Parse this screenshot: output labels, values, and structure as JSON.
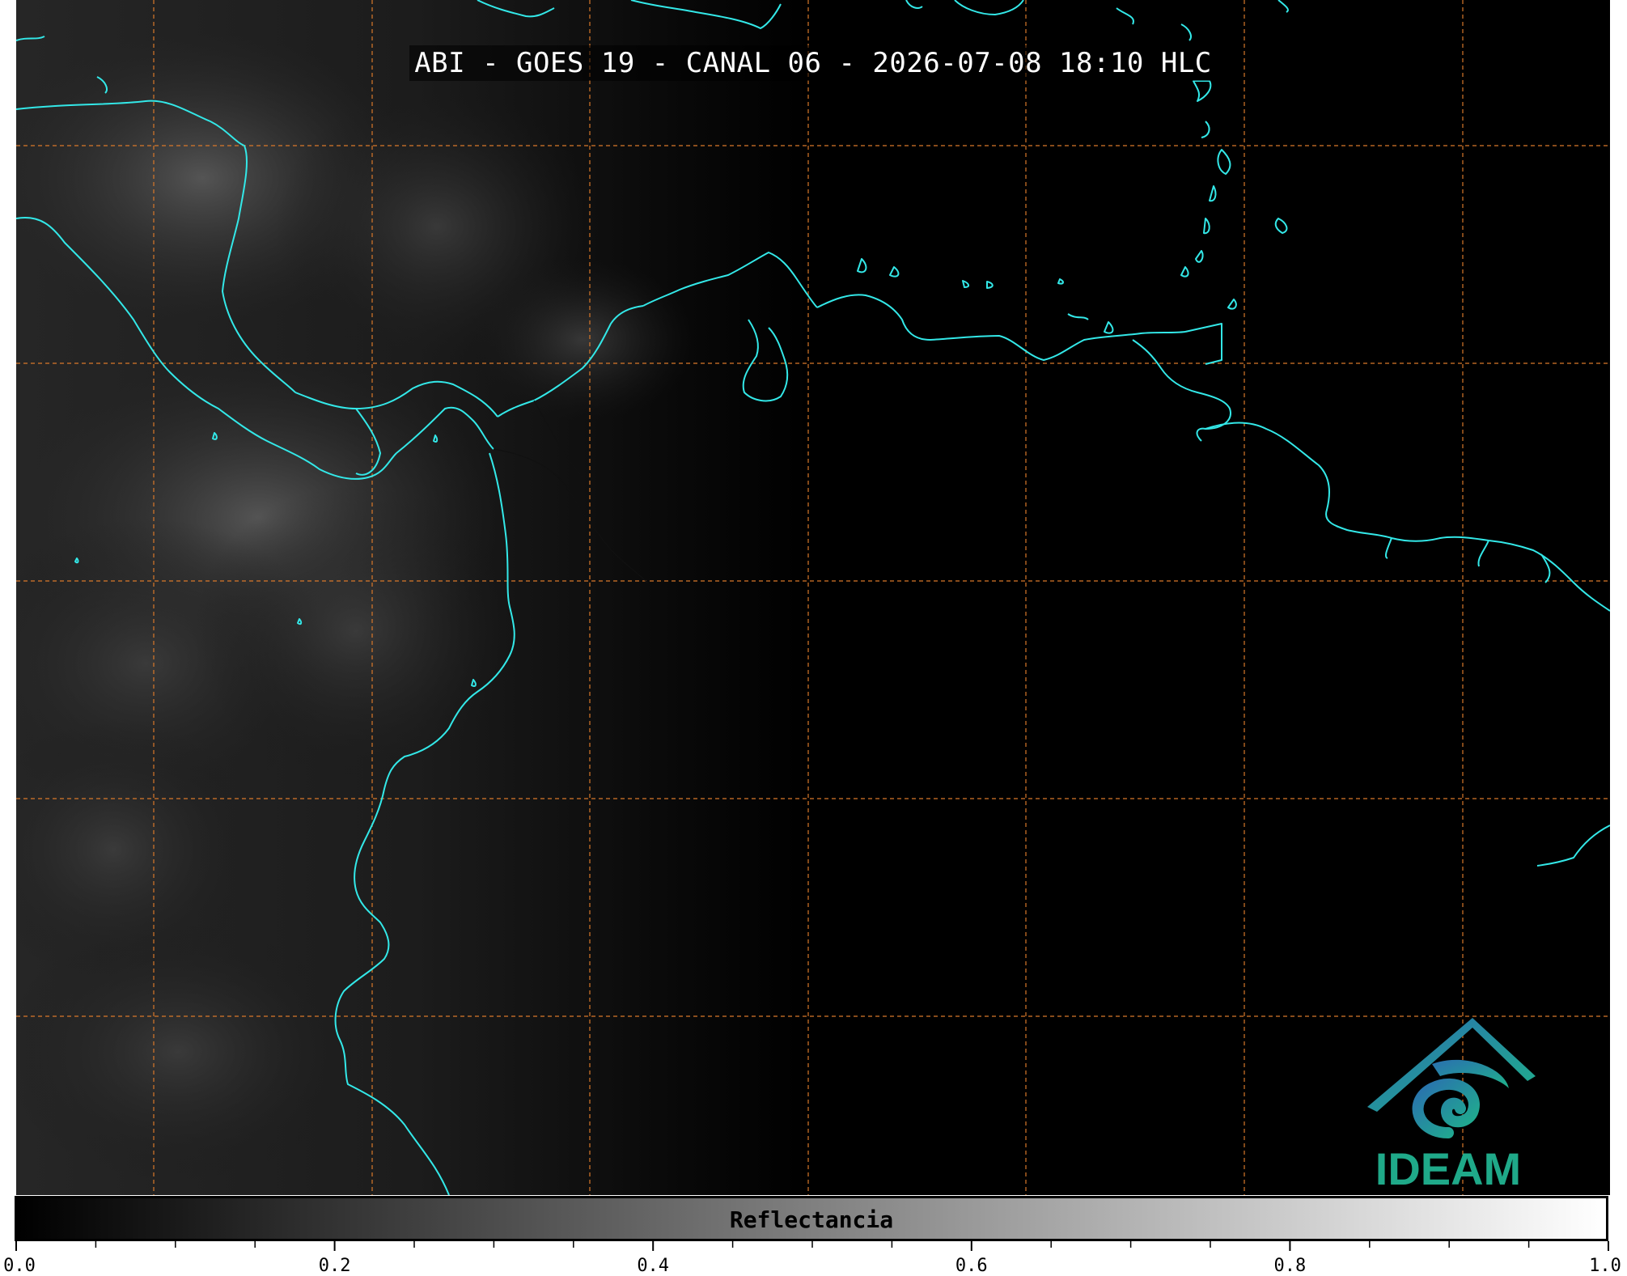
{
  "title": "ABI - GOES 19 - CANAL 06 - 2026-07-08 18:10 HLC",
  "colorbar": {
    "label": "Reflectancia",
    "range": [
      0.0,
      1.0
    ],
    "ticks": [
      "0.0",
      "0.2",
      "0.4",
      "0.6",
      "0.8",
      "1.0"
    ],
    "gradient_start": "#000000",
    "gradient_end": "#ffffff"
  },
  "logo": {
    "text": "IDEAM",
    "color": "#1fa989",
    "icon": "ideam-spiral-mountain-icon"
  },
  "map": {
    "background": "#000000",
    "coastline_color": "#33e8e8",
    "gridline_color": "#d9782a",
    "gridline_style": "dashed",
    "cloud_region": "west and southwest"
  }
}
